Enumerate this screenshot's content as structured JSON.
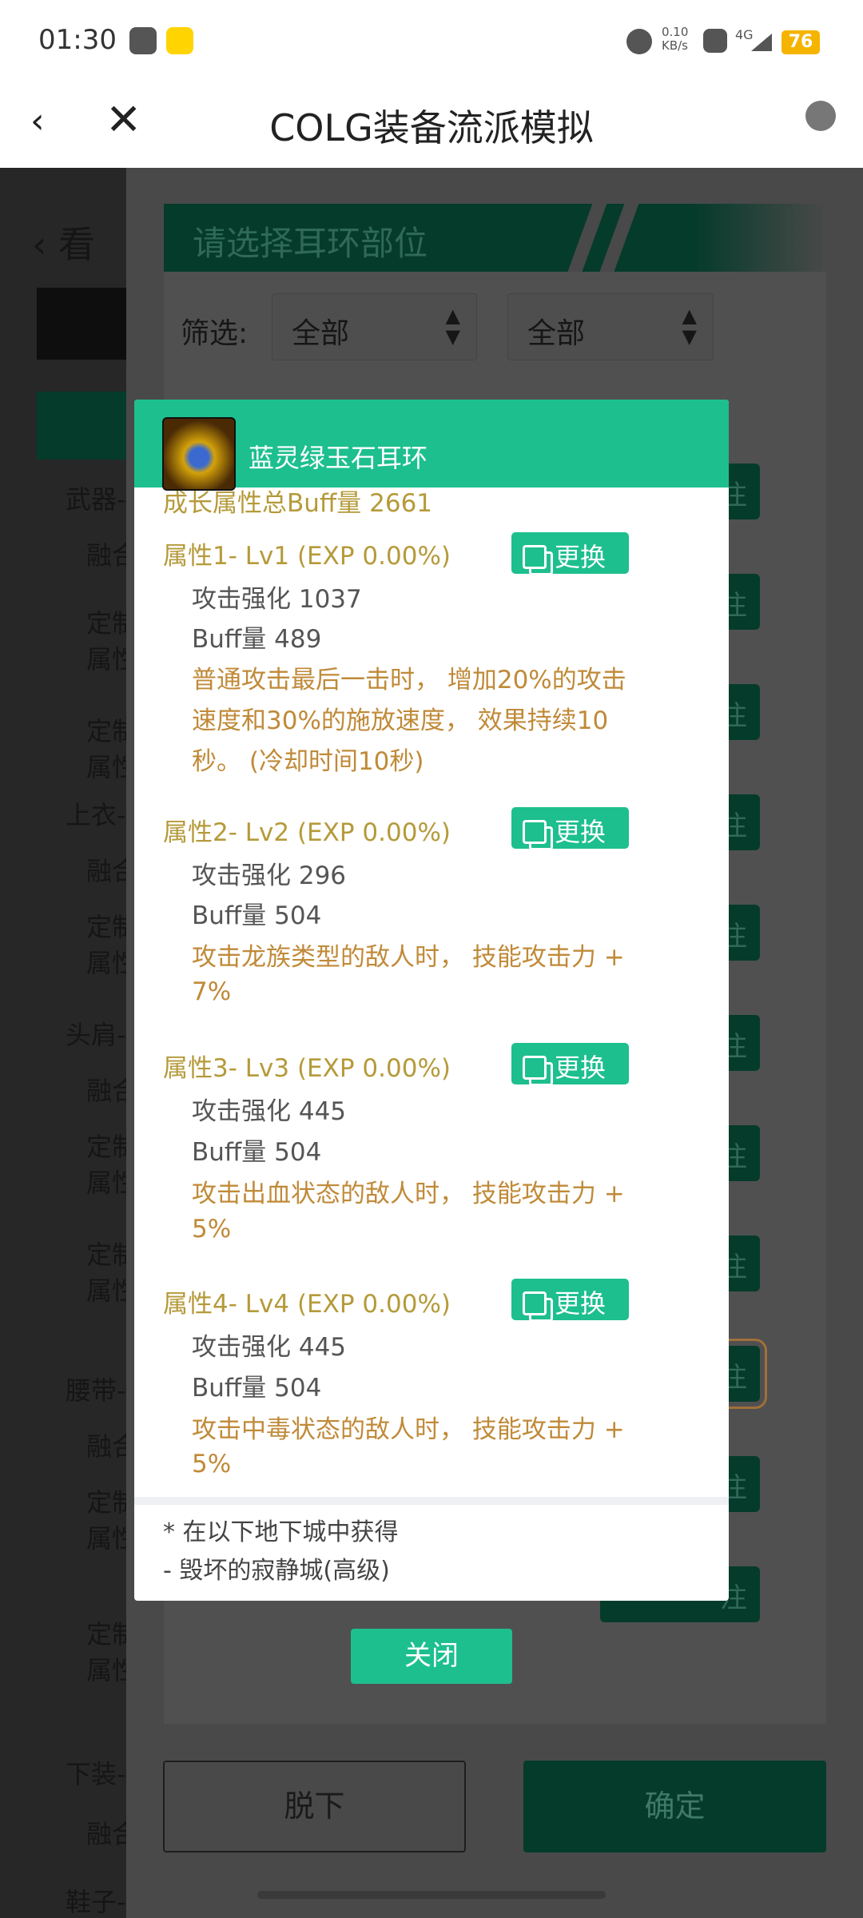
{
  "status": {
    "time": "01:30",
    "speed": "0.10",
    "speed_unit": "KB/s",
    "network": "4G",
    "battery": "76"
  },
  "appbar": {
    "title": "COLG装备流派模拟",
    "back_icon": "chevron-left-icon",
    "close_icon": "close-icon",
    "globe_icon": "globe-icon"
  },
  "background": {
    "left_labels": [
      "看",
      "武器-",
      "融合",
      "定制",
      "属性",
      "定制",
      "属性",
      "上衣-",
      "融合",
      "定制",
      "属性",
      "头肩-",
      "融合",
      "定制",
      "属性",
      "定制",
      "属性",
      "腰带-",
      "融合",
      "定制",
      "属性",
      "定制",
      "属性",
      "下装-",
      "融合",
      "鞋子-"
    ],
    "banner_title": "请选择耳环部位",
    "filter_label": "筛选:",
    "filter1": "全部",
    "filter2": "全部",
    "item_button_suffix": "注",
    "unequip": "脱下",
    "confirm": "确定"
  },
  "modal": {
    "item_name": "蓝灵绿玉石耳环",
    "clipped_line": "成长属性总Buff量 2661",
    "change_label": "更换",
    "attributes": [
      {
        "title": "属性1- Lv1 (EXP 0.00%)",
        "stats": [
          "攻击强化 1037",
          "Buff量 489"
        ],
        "desc": [
          "普通攻击最后一击时， 增加20%的攻击",
          "速度和30%的施放速度， 效果持续10",
          "秒。 (冷却时间10秒)"
        ]
      },
      {
        "title": "属性2- Lv2 (EXP 0.00%)",
        "stats": [
          "攻击强化 296",
          "Buff量 504"
        ],
        "desc": [
          "攻击龙族类型的敌人时， 技能攻击力 +",
          "7%"
        ]
      },
      {
        "title": "属性3- Lv3 (EXP 0.00%)",
        "stats": [
          "攻击强化 445",
          "Buff量 504"
        ],
        "desc": [
          "攻击出血状态的敌人时， 技能攻击力 +",
          "5%"
        ]
      },
      {
        "title": "属性4- Lv4 (EXP 0.00%)",
        "stats": [
          "攻击强化 445",
          "Buff量 504"
        ],
        "desc": [
          "攻击中毒状态的敌人时， 技能攻击力 +",
          "5%"
        ]
      }
    ],
    "source": [
      "* 在以下地下城中获得",
      "- 毁坏的寂静城(高级)"
    ],
    "close_label": "关闭"
  },
  "colors": {
    "accent": "#1dbf8e",
    "dark_green": "#053b2b",
    "gold": "#b59a3a",
    "desc": "#c08a38"
  }
}
